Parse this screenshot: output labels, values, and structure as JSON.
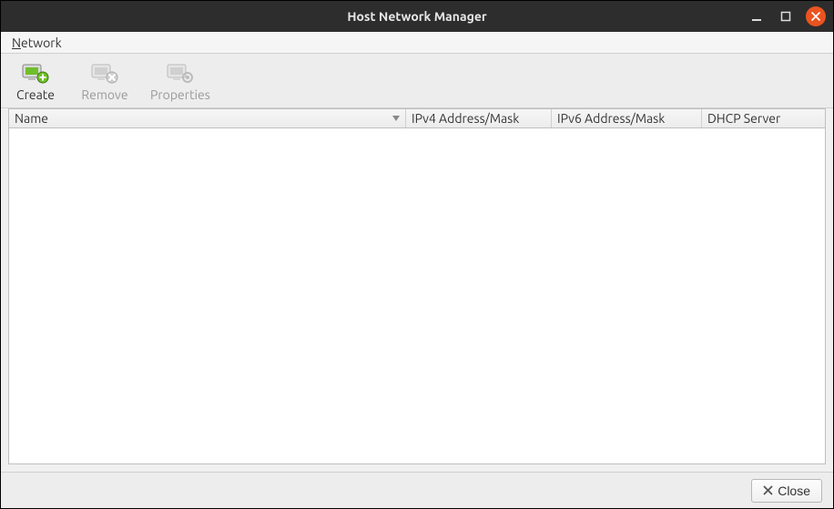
{
  "window": {
    "title": "Host Network Manager"
  },
  "menu": {
    "network": "Network"
  },
  "toolbar": {
    "create_label": "Create",
    "remove_label": "Remove",
    "properties_label": "Properties"
  },
  "columns": {
    "name": "Name",
    "ipv4": "IPv4 Address/Mask",
    "ipv6": "IPv6 Address/Mask",
    "dhcp": "DHCP Server"
  },
  "rows": [],
  "footer": {
    "close_label": "Close"
  }
}
